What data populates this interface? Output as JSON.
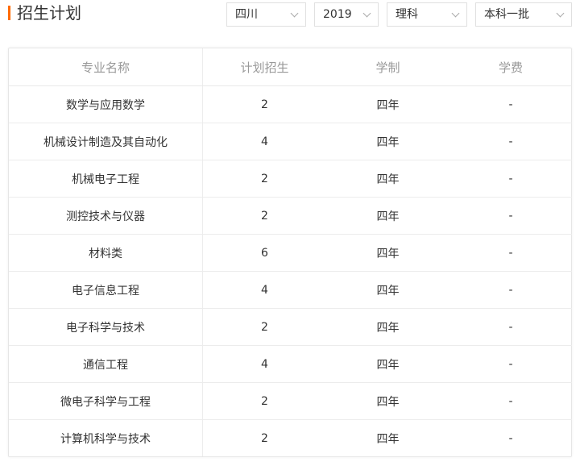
{
  "header": {
    "title": "招生计划"
  },
  "filters": {
    "province": "四川",
    "year": "2019",
    "subject": "理科",
    "batch": "本科一批"
  },
  "table": {
    "columns": [
      "专业名称",
      "计划招生",
      "学制",
      "学费"
    ],
    "rows": [
      {
        "major": "数学与应用数学",
        "plan": "2",
        "duration": "四年",
        "fee": "-"
      },
      {
        "major": "机械设计制造及其自动化",
        "plan": "4",
        "duration": "四年",
        "fee": "-"
      },
      {
        "major": "机械电子工程",
        "plan": "2",
        "duration": "四年",
        "fee": "-"
      },
      {
        "major": "测控技术与仪器",
        "plan": "2",
        "duration": "四年",
        "fee": "-"
      },
      {
        "major": "材料类",
        "plan": "6",
        "duration": "四年",
        "fee": "-"
      },
      {
        "major": "电子信息工程",
        "plan": "4",
        "duration": "四年",
        "fee": "-"
      },
      {
        "major": "电子科学与技术",
        "plan": "2",
        "duration": "四年",
        "fee": "-"
      },
      {
        "major": "通信工程",
        "plan": "4",
        "duration": "四年",
        "fee": "-"
      },
      {
        "major": "微电子科学与工程",
        "plan": "2",
        "duration": "四年",
        "fee": "-"
      },
      {
        "major": "计算机科学与技术",
        "plan": "2",
        "duration": "四年",
        "fee": "-"
      }
    ]
  }
}
